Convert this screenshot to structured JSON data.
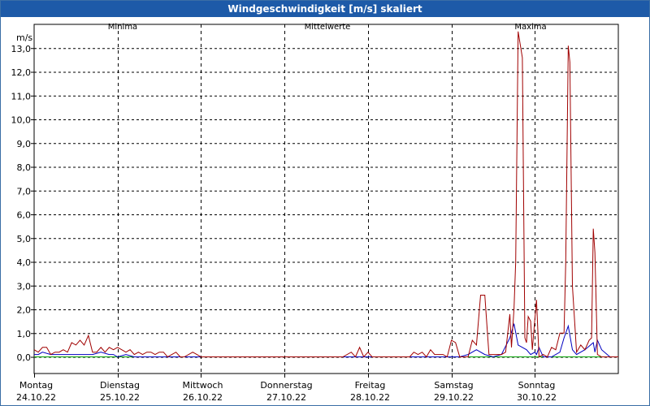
{
  "window": {
    "title": "Windgeschwindigkeit [m/s] skaliert"
  },
  "chart_data": {
    "type": "line",
    "title": "Windgeschwindigkeit [m/s] skaliert",
    "ylabel": "m/s",
    "xlabel": "",
    "ylim": [
      -0.7,
      14.0
    ],
    "yticks": [
      "0,0",
      "1,0",
      "2,0",
      "3,0",
      "4,0",
      "5,0",
      "6,0",
      "7,0",
      "8,0",
      "9,0",
      "10,0",
      "11,0",
      "12,0",
      "13,0"
    ],
    "ytick_values": [
      0,
      1,
      2,
      3,
      4,
      5,
      6,
      7,
      8,
      9,
      10,
      11,
      12,
      13
    ],
    "xlim": [
      0,
      7
    ],
    "days": [
      {
        "day": "Montag",
        "date": "24.10.22"
      },
      {
        "day": "Dienstag",
        "date": "25.10.22"
      },
      {
        "day": "Mittwoch",
        "date": "26.10.22"
      },
      {
        "day": "Donnerstag",
        "date": "27.10.22"
      },
      {
        "day": "Freitag",
        "date": "28.10.22"
      },
      {
        "day": "Samstag",
        "date": "29.10.22"
      },
      {
        "day": "Sonntag",
        "date": "30.10.22"
      }
    ],
    "grid": true,
    "legend_position": "top",
    "series": [
      {
        "name": "Minima",
        "color": "#00a000",
        "x": [
          0,
          7
        ],
        "y": [
          0.0,
          0.0
        ]
      },
      {
        "name": "Mittelwerte",
        "color": "#0000c0",
        "x": [
          0,
          0.05,
          0.1,
          0.2,
          0.3,
          0.4,
          0.5,
          0.6,
          0.7,
          0.8,
          0.9,
          0.95,
          1.0,
          1.1,
          1.2,
          1.3,
          1.4,
          1.5,
          1.6,
          1.7,
          1.8,
          1.9,
          2.0,
          3.0,
          3.9,
          4.0,
          4.1,
          4.2,
          4.5,
          5.0,
          5.1,
          5.2,
          5.3,
          5.4,
          5.5,
          5.6,
          5.7,
          5.75,
          5.8,
          5.9,
          5.95,
          6.0,
          6.02,
          6.05,
          6.1,
          6.2,
          6.3,
          6.35,
          6.4,
          6.45,
          6.5,
          6.6,
          6.7,
          6.72,
          6.75,
          6.8,
          6.9,
          7.0
        ],
        "y": [
          0.1,
          0.1,
          0.2,
          0.1,
          0.1,
          0.1,
          0.1,
          0.1,
          0.1,
          0.2,
          0.1,
          0.1,
          0.0,
          0.1,
          0.0,
          0.0,
          0.0,
          0.0,
          0.0,
          0.0,
          0.0,
          0.0,
          0.0,
          0.0,
          0.0,
          0.0,
          0.0,
          0.0,
          0.0,
          0.0,
          0.0,
          0.1,
          0.3,
          0.1,
          0.0,
          0.1,
          0.8,
          1.4,
          0.5,
          0.3,
          0.1,
          0.2,
          0.1,
          0.4,
          0.0,
          0.0,
          0.2,
          0.8,
          1.3,
          0.3,
          0.1,
          0.3,
          0.6,
          0.2,
          0.7,
          0.3,
          0.0,
          0.0
        ]
      },
      {
        "name": "Maxima",
        "color": "#a00000",
        "x": [
          0,
          0.05,
          0.1,
          0.15,
          0.2,
          0.25,
          0.3,
          0.35,
          0.4,
          0.45,
          0.5,
          0.55,
          0.6,
          0.65,
          0.7,
          0.75,
          0.8,
          0.85,
          0.9,
          0.95,
          1.0,
          1.05,
          1.1,
          1.15,
          1.2,
          1.25,
          1.3,
          1.35,
          1.4,
          1.45,
          1.5,
          1.55,
          1.6,
          1.65,
          1.7,
          1.75,
          1.8,
          1.9,
          1.95,
          2.0,
          2.5,
          3.0,
          3.7,
          3.8,
          3.85,
          3.9,
          3.95,
          4.0,
          4.05,
          4.1,
          4.15,
          4.2,
          4.5,
          4.55,
          4.6,
          4.65,
          4.7,
          4.75,
          4.8,
          4.9,
          4.95,
          5.0,
          5.05,
          5.1,
          5.2,
          5.25,
          5.3,
          5.35,
          5.4,
          5.45,
          5.5,
          5.55,
          5.6,
          5.65,
          5.7,
          5.72,
          5.75,
          5.77,
          5.8,
          5.85,
          5.88,
          5.9,
          5.92,
          5.95,
          5.97,
          6.0,
          6.02,
          6.05,
          6.1,
          6.15,
          6.2,
          6.25,
          6.3,
          6.35,
          6.37,
          6.4,
          6.42,
          6.45,
          6.5,
          6.55,
          6.6,
          6.65,
          6.68,
          6.7,
          6.72,
          6.75,
          6.8,
          6.9,
          7.0
        ],
        "y": [
          0.3,
          0.2,
          0.4,
          0.4,
          0.1,
          0.2,
          0.2,
          0.3,
          0.2,
          0.6,
          0.5,
          0.7,
          0.5,
          0.9,
          0.2,
          0.2,
          0.4,
          0.2,
          0.4,
          0.3,
          0.4,
          0.3,
          0.2,
          0.3,
          0.1,
          0.2,
          0.1,
          0.2,
          0.2,
          0.1,
          0.2,
          0.2,
          0.0,
          0.1,
          0.2,
          0.0,
          0.0,
          0.2,
          0.1,
          0.0,
          0.0,
          0.0,
          0.0,
          0.2,
          0.0,
          0.4,
          0.0,
          0.2,
          0.0,
          0.0,
          0.0,
          0.0,
          0.0,
          0.2,
          0.1,
          0.2,
          0.0,
          0.3,
          0.1,
          0.1,
          0.0,
          0.7,
          0.6,
          0.0,
          0.0,
          0.7,
          0.5,
          2.6,
          2.6,
          0.1,
          0.1,
          0.1,
          0.1,
          0.2,
          1.8,
          0.4,
          2.0,
          4.0,
          13.7,
          12.6,
          0.8,
          0.6,
          1.7,
          1.5,
          0.3,
          1.6,
          2.4,
          0.0,
          0.1,
          0.0,
          0.4,
          0.3,
          1.0,
          1.0,
          4.0,
          13.1,
          12.4,
          3.0,
          0.2,
          0.5,
          0.3,
          0.7,
          0.8,
          5.4,
          4.4,
          0.1,
          0.0,
          0.0,
          0.0
        ]
      }
    ]
  }
}
